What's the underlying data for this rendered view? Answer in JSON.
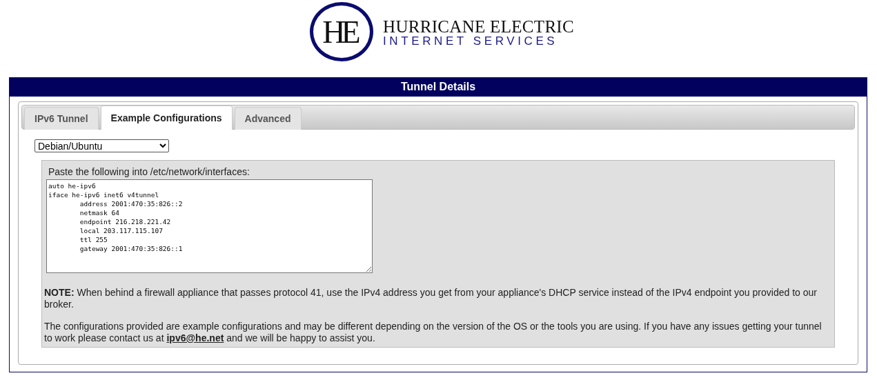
{
  "logo": {
    "mark": "HE",
    "line1": "HURRICANE ELECTRIC",
    "line2": "INTERNET SERVICES"
  },
  "panel": {
    "title": "Tunnel Details"
  },
  "tabs": [
    {
      "label": "IPv6 Tunnel",
      "selected": false
    },
    {
      "label": "Example Configurations",
      "selected": true
    },
    {
      "label": "Advanced",
      "selected": false
    }
  ],
  "os_select": {
    "value": "Debian/Ubuntu"
  },
  "config": {
    "instruction": "Paste the following into /etc/network/interfaces:",
    "text": "auto he-ipv6\niface he-ipv6 inet6 v4tunnel\n\taddress 2001:470:35:826::2\n\tnetmask 64\n\tendpoint 216.218.221.42\n\tlocal 203.117.115.107\n\tttl 255\n\tgateway 2001:470:35:826::1"
  },
  "note": "**NOTE:** When behind a firewall appliance that passes protocol 41, use the IPv4 address you get from your appliance's DHCP service instead of the IPv4 endpoint you provided to our broker.",
  "disclaimer": {
    "before": "The configurations provided are example configurations and may be different depending on the version of the OS or the tools you are using. If you have any issues getting your tunnel to work please contact us at ",
    "link": "ipv6@he.net",
    "after": " and we will be happy to assist you."
  }
}
